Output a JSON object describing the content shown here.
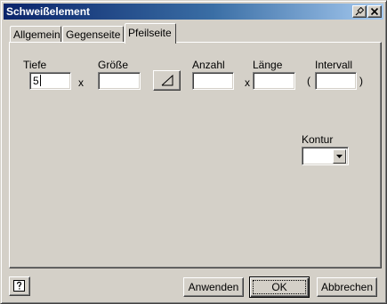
{
  "window": {
    "title": "Schweißelement",
    "pin_icon": "pin-icon",
    "close_icon": "close-icon"
  },
  "tabs": [
    {
      "label": "Allgemein",
      "active": false
    },
    {
      "label": "Gegenseite",
      "active": false
    },
    {
      "label": "Pfeilseite",
      "active": true
    }
  ],
  "fields": {
    "tiefe": {
      "label": "Tiefe",
      "value": "5"
    },
    "x1": "x",
    "groesse": {
      "label": "Größe",
      "value": ""
    },
    "contour_icon": "fillet-weld-symbol-icon",
    "anzahl": {
      "label": "Anzahl",
      "value": ""
    },
    "x2": "x",
    "laenge": {
      "label": "Länge",
      "value": ""
    },
    "intervall": {
      "label": "Intervall",
      "value": "",
      "paren_open": "(",
      "paren_close": ")"
    },
    "kontur": {
      "label": "Kontur",
      "value": ""
    }
  },
  "footer": {
    "help_icon": "help-icon",
    "apply": "Anwenden",
    "ok": "OK",
    "cancel": "Abbrechen"
  }
}
